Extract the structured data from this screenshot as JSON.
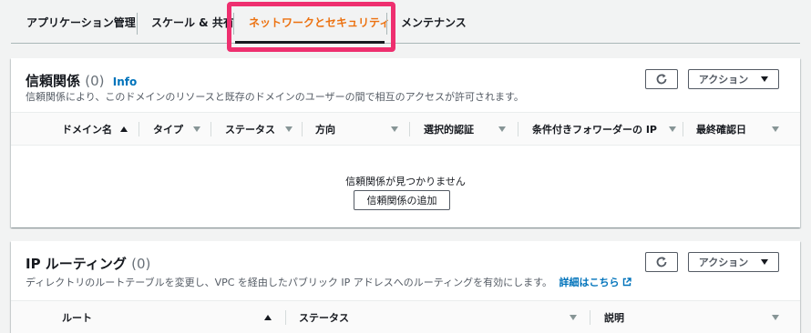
{
  "tabs": [
    {
      "label": "アプリケーション管理"
    },
    {
      "label": "スケール & 共有"
    },
    {
      "label": "ネットワークとセキュリティ"
    },
    {
      "label": "メンテナンス"
    }
  ],
  "active_tab": "ネットワークとセキュリティ",
  "trust": {
    "title": "信頼関係",
    "count": "(0)",
    "info": "Info",
    "description": "信頼関係により、このドメインのリソースと既存のドメインのユーザーの間で相互のアクセスが許可されます。",
    "action_label": "アクション",
    "columns": [
      "ドメイン名",
      "タイプ",
      "ステータス",
      "方向",
      "選択的認証",
      "条件付きフォワーダーの IP",
      "最終確認日"
    ],
    "empty_text": "信頼関係が見つかりません",
    "add_button": "信頼関係の追加"
  },
  "routing": {
    "title": "IP ルーティング",
    "count": "(0)",
    "description": "ディレクトリのルートテーブルを変更し、VPC を経由したパブリック IP アドレスへのルーティングを有効にします。",
    "details_link": "詳細はこちら",
    "action_label": "アクション",
    "columns": [
      "ルート",
      "ステータス",
      "説明"
    ]
  },
  "colors": {
    "accent": "#ec7211",
    "highlight": "#ee2f6f",
    "link": "#0073bb"
  }
}
